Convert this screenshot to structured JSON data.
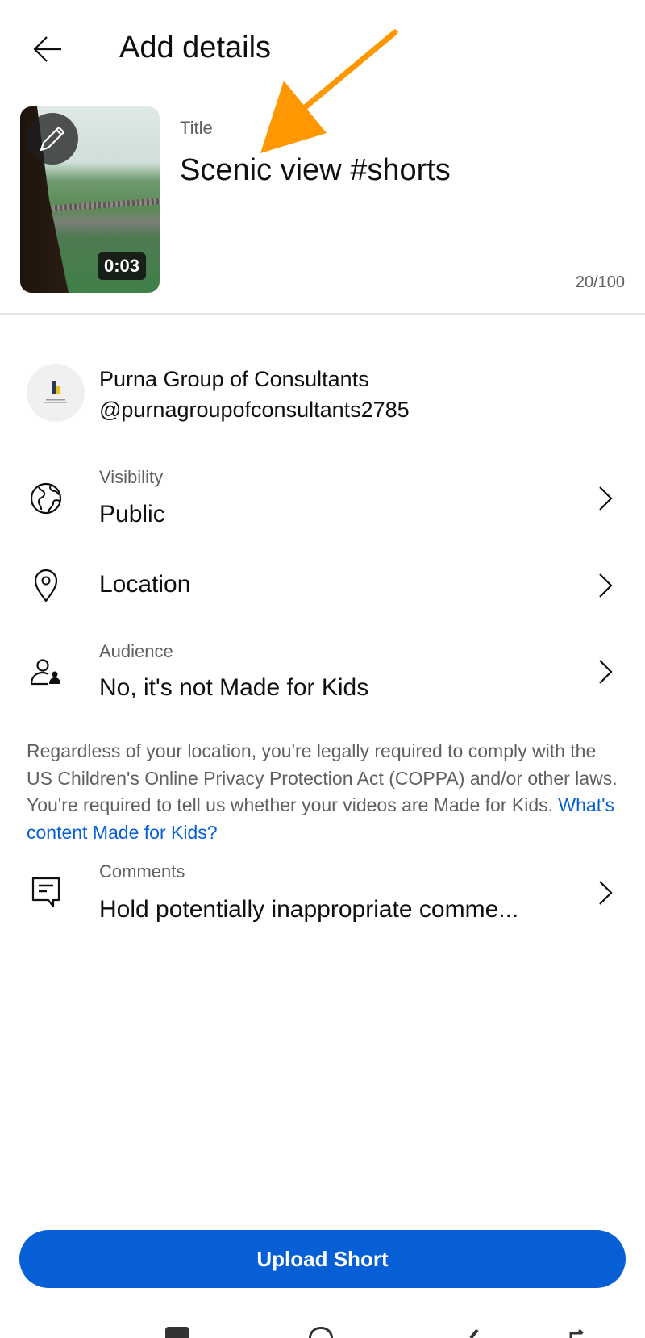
{
  "header": {
    "title": "Add details",
    "back_icon": "arrow-left-icon"
  },
  "video": {
    "duration": "0:03",
    "edit_icon": "pencil-icon"
  },
  "title_field": {
    "label": "Title",
    "value": "Scenic view #shorts",
    "counter": "20/100"
  },
  "annotation": {
    "color": "#ff9800",
    "type": "arrow"
  },
  "channel": {
    "name": "Purna Group of Consultants",
    "handle": "@purnagroupofconsultants2785"
  },
  "settings": [
    {
      "icon": "globe-icon",
      "label": "Visibility",
      "value": "Public"
    },
    {
      "icon": "location-pin-icon",
      "label": "",
      "value": "Location"
    },
    {
      "icon": "audience-icon",
      "label": "Audience",
      "value": "No, it's not Made for Kids"
    },
    {
      "icon": "comment-icon",
      "label": "Comments",
      "value": "Hold potentially inappropriate comme..."
    }
  ],
  "disclaimer": {
    "text": "Regardless of your location, you're legally required to comply with the US Children's Online Privacy Protection Act (COPPA) and/or other laws. You're required to tell us whether your videos are Made for Kids. ",
    "link": "What's content Made for Kids?"
  },
  "upload_button": {
    "label": "Upload Short"
  },
  "colors": {
    "accent": "#065fd4",
    "link": "#065fd4"
  }
}
